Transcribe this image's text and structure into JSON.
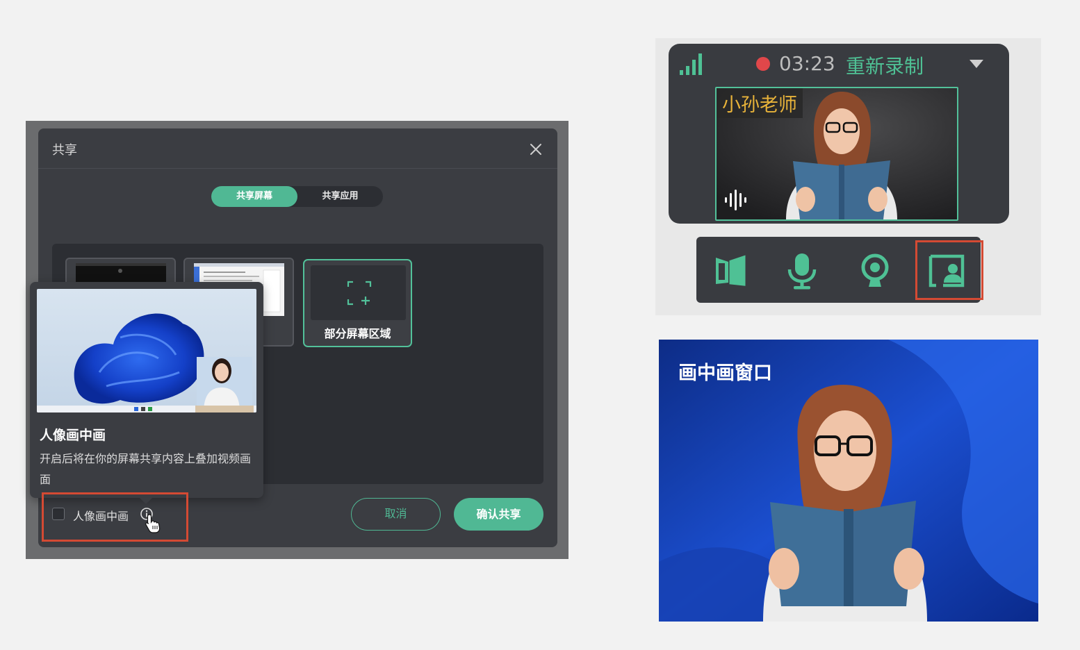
{
  "share_dialog": {
    "title": "共享",
    "close_icon": "close-icon",
    "tabs": [
      {
        "label": "共享屏幕",
        "active": true
      },
      {
        "label": "共享应用",
        "active": false
      }
    ],
    "region_option_label": "部分屏幕区域",
    "pip_checkbox_label": "人像画中画",
    "pip_checkbox_checked": false,
    "cancel_label": "取消",
    "confirm_label": "确认共享",
    "accent_color": "#50b894"
  },
  "tooltip": {
    "title": "人像画中画",
    "description": "开启后将在你的屏幕共享内容上叠加视频画面"
  },
  "recorder": {
    "time": "03:23",
    "restart_label": "重新录制",
    "camera_name": "小孙老师",
    "recording_color": "#e0474a",
    "controls": [
      {
        "name": "share-screen-icon"
      },
      {
        "name": "microphone-icon"
      },
      {
        "name": "camera-icon"
      },
      {
        "name": "portrait-pip-icon",
        "highlighted": true
      }
    ]
  },
  "pip_window": {
    "title": "画中画窗口"
  }
}
